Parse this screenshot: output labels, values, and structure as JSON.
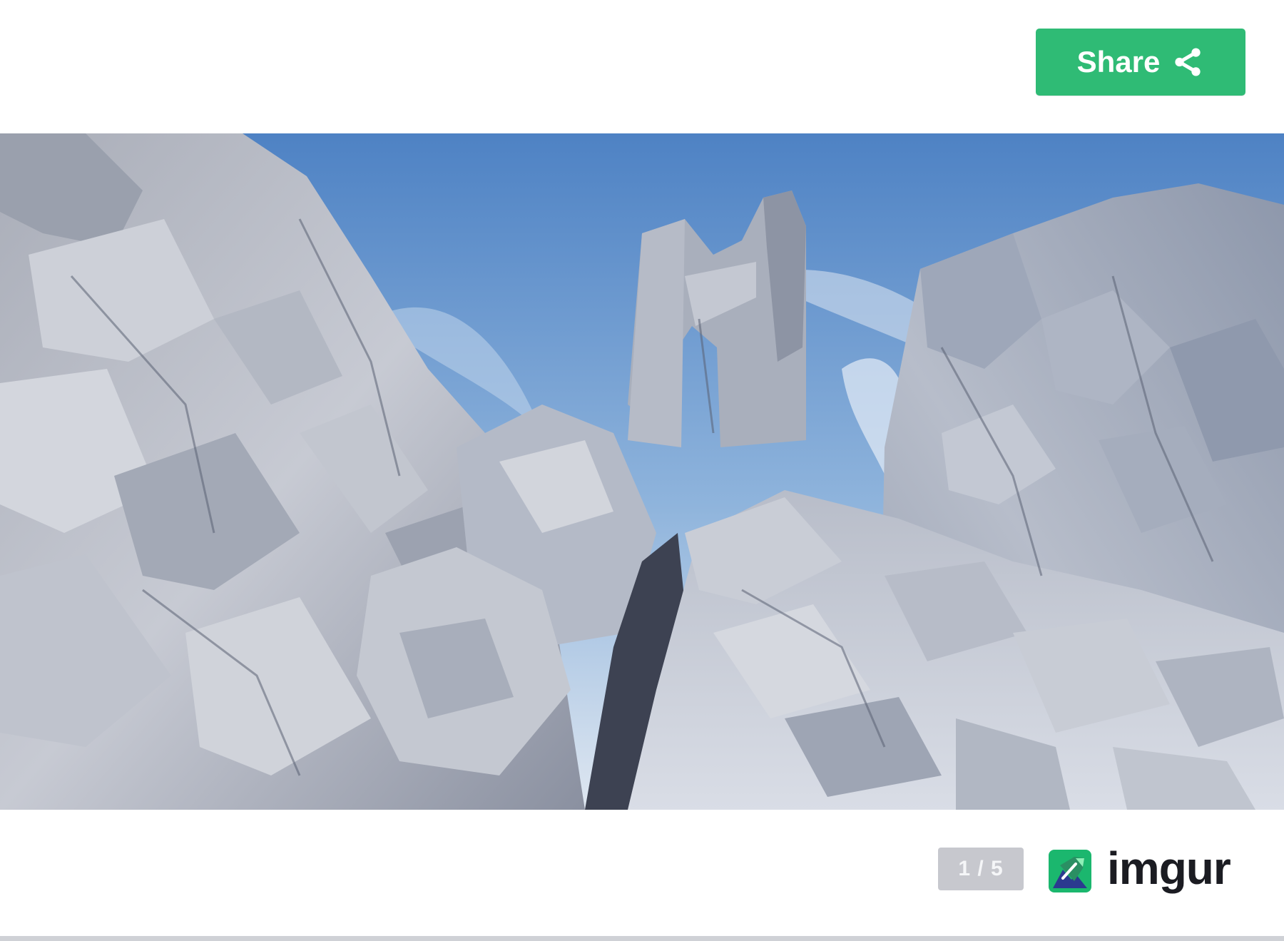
{
  "share": {
    "label": "Share",
    "icon": "share-icon",
    "color": "#2fbb75"
  },
  "gallery": {
    "position": "1 / 5",
    "current": 1,
    "total": 5
  },
  "image": {
    "alt": "Rocky cliffs with a natural stone arch under a blue sky"
  },
  "brand": {
    "name": "imgur",
    "logo_icon": "imgur-logo-icon",
    "logo_color": "#1bb76e"
  }
}
